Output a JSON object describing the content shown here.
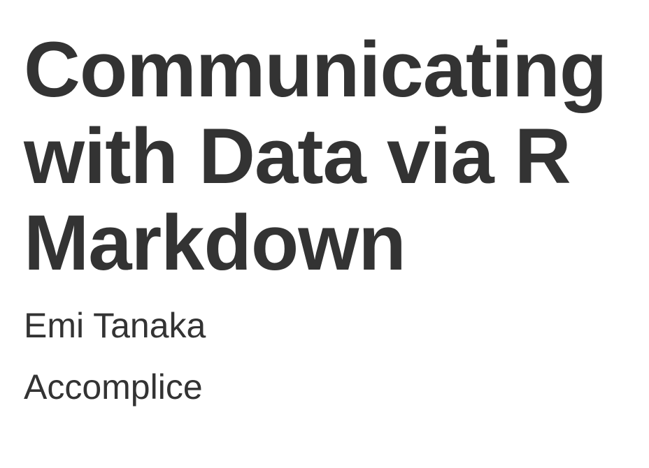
{
  "slide": {
    "title": "Communicating with Data via R Markdown",
    "author": "Emi Tanaka",
    "affiliation": "Accomplice"
  }
}
